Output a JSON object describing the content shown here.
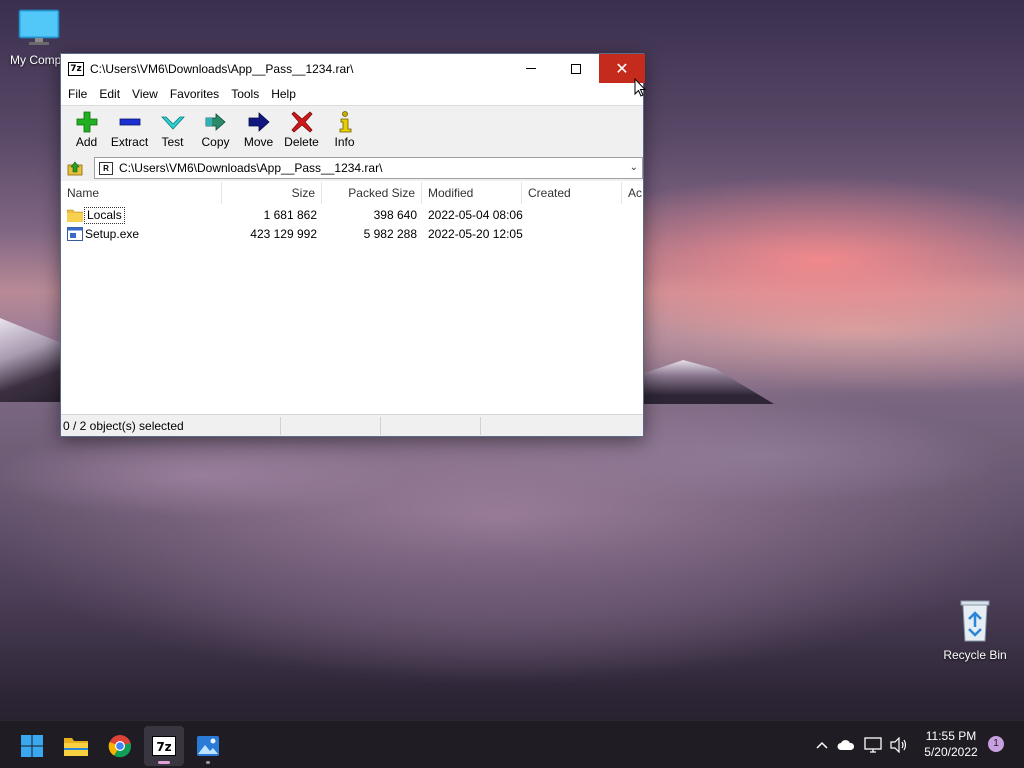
{
  "desktop": {
    "icons": [
      {
        "label": "My Compu",
        "icon": "monitor-icon"
      },
      {
        "label": "Recycle Bin",
        "icon": "recycle-bin-icon"
      }
    ]
  },
  "window": {
    "title": "C:\\Users\\VM6\\Downloads\\App__Pass__1234.rar\\",
    "app_icon_text": "7z",
    "controls": {
      "minimize": "minimize-icon",
      "maximize": "maximize-icon",
      "close": "✕"
    },
    "menu": [
      "File",
      "Edit",
      "View",
      "Favorites",
      "Tools",
      "Help"
    ],
    "toolbar": [
      {
        "label": "Add",
        "icon": "plus-icon",
        "color": "#22b020"
      },
      {
        "label": "Extract",
        "icon": "minus-icon",
        "color": "#1a2fd0"
      },
      {
        "label": "Test",
        "icon": "checkmark-icon",
        "color": "#20c0c0"
      },
      {
        "label": "Copy",
        "icon": "double-arrow-icon",
        "color": "#208060"
      },
      {
        "label": "Move",
        "icon": "arrow-right-icon",
        "color": "#101880"
      },
      {
        "label": "Delete",
        "icon": "x-icon",
        "color": "#d01818"
      },
      {
        "label": "Info",
        "icon": "info-icon",
        "color": "#c8b000"
      }
    ],
    "address": {
      "path": "C:\\Users\\VM6\\Downloads\\App__Pass__1234.rar\\",
      "icon_text": "R"
    },
    "columns": [
      "Name",
      "Size",
      "Packed Size",
      "Modified",
      "Created",
      "Ac"
    ],
    "rows": [
      {
        "name": "Locals",
        "size": "1 681 862",
        "packed": "398 640",
        "modified": "2022-05-04 08:06",
        "created": "",
        "icon": "folder-icon"
      },
      {
        "name": "Setup.exe",
        "size": "423 129 992",
        "packed": "5 982 288",
        "modified": "2022-05-20 12:05",
        "created": "",
        "icon": "exe-file-icon"
      }
    ],
    "status": "0 / 2 object(s) selected"
  },
  "taskbar": {
    "apps": [
      {
        "name": "start-button",
        "icon": "windows-logo-icon"
      },
      {
        "name": "file-explorer",
        "icon": "folder-icon"
      },
      {
        "name": "chrome",
        "icon": "chrome-icon"
      },
      {
        "name": "7zip",
        "icon": "7z-icon",
        "text": "7z"
      },
      {
        "name": "photos",
        "icon": "photos-icon"
      }
    ],
    "tray": {
      "time": "11:55 PM",
      "date": "5/20/2022",
      "notification_count": "1"
    }
  },
  "colors": {
    "close_button": "#c42b1c",
    "taskbar": "#1f1c24",
    "toolbar_bg": "#f0f0f0"
  }
}
